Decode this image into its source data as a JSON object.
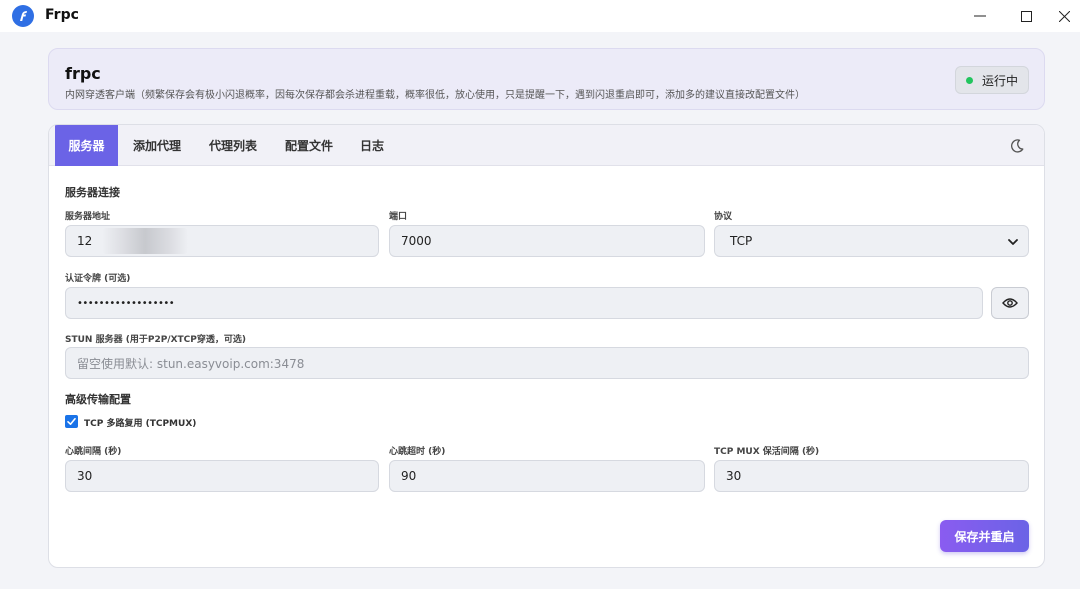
{
  "window": {
    "title": "Frpc",
    "minimize_icon": "minimize-icon",
    "maximize_icon": "maximize-icon",
    "close_icon": "close-icon"
  },
  "header": {
    "title": "frpc",
    "description": "内网穿透客户端（频繁保存会有极小闪退概率，因每次保存都会杀进程重载，概率很低，放心使用，只是提醒一下，遇到闪退重启即可，添加多的建议直接改配置文件）",
    "status": "运行中",
    "status_color": "#22c55e"
  },
  "tabs": [
    {
      "label": "服务器",
      "active": true
    },
    {
      "label": "添加代理",
      "active": false
    },
    {
      "label": "代理列表",
      "active": false
    },
    {
      "label": "配置文件",
      "active": false
    },
    {
      "label": "日志",
      "active": false
    }
  ],
  "accent_color": "#6b63e6",
  "server": {
    "section_title": "服务器连接",
    "address_label": "服务器地址",
    "address_value": "12",
    "port_label": "端口",
    "port_value": "7000",
    "protocol_label": "协议",
    "protocol_value": "TCP",
    "token_label": "认证令牌 (可选)",
    "token_value": "••••••••••••••••••",
    "stun_label": "STUN 服务器 (用于P2P/XTCP穿透，可选)",
    "stun_placeholder": "留空使用默认: stun.easyvoip.com:3478"
  },
  "advanced": {
    "section_title": "高级传输配置",
    "tcpmux_label": "TCP 多路复用 (TCPMUX)",
    "tcpmux_checked": true,
    "heartbeat_interval_label": "心跳间隔 (秒)",
    "heartbeat_interval_value": "30",
    "heartbeat_timeout_label": "心跳超时 (秒)",
    "heartbeat_timeout_value": "90",
    "tcpmux_keepalive_label": "TCP MUX 保活间隔 (秒)",
    "tcpmux_keepalive_value": "30"
  },
  "save_button": "保存并重启"
}
